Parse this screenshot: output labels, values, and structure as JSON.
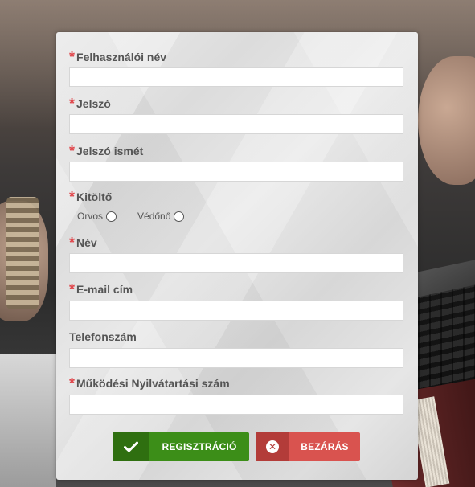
{
  "form": {
    "fields": [
      {
        "label": "Felhasználói név",
        "required": true,
        "value": ""
      },
      {
        "label": "Jelszó",
        "required": true,
        "value": ""
      },
      {
        "label": "Jelszó ismét",
        "required": true,
        "value": ""
      },
      {
        "label": "Kitöltő",
        "required": true
      },
      {
        "label": "Név",
        "required": true,
        "value": ""
      },
      {
        "label": "E-mail cím",
        "required": true,
        "value": ""
      },
      {
        "label": "Telefonszám",
        "required": false,
        "value": ""
      },
      {
        "label": "Működési Nyilvátartási szám",
        "required": true,
        "value": ""
      }
    ],
    "required_marker": "*",
    "radio_options": [
      {
        "label": "Orvos",
        "checked": false
      },
      {
        "label": "Védőnő",
        "checked": false
      }
    ]
  },
  "buttons": {
    "register_label": "REGISZTRÁCIÓ",
    "register_icon": "checkmark-icon",
    "close_label": "BEZÁRÁS",
    "close_icon": "close-circle-icon"
  },
  "colors": {
    "required": "#e0474c",
    "register": "#3c8e18",
    "close": "#d9534f"
  }
}
